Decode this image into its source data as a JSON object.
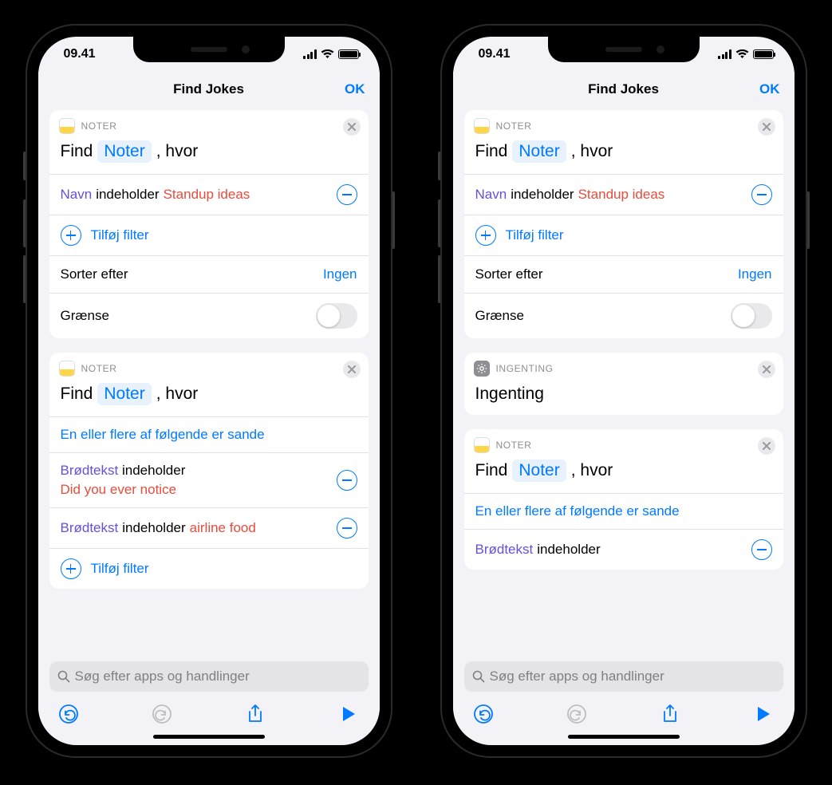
{
  "status": {
    "time": "09.41"
  },
  "nav": {
    "title": "Find Jokes",
    "done": "OK"
  },
  "tokens": {
    "find": "Find",
    "notes_token": "Noter",
    "where": ", hvor"
  },
  "apps": {
    "notes": "NOTER",
    "nothing": "INGENTING"
  },
  "filter1": {
    "attr": "Navn",
    "op": "indeholder",
    "val": "Standup ideas"
  },
  "add_filter": "Tilføj filter",
  "sort": {
    "label": "Sorter efter",
    "value": "Ingen"
  },
  "limit": {
    "label": "Grænse"
  },
  "cond_group": "En eller flere af følgende er sande",
  "filter2a": {
    "attr": "Brødtekst",
    "op": "indeholder",
    "val": "Did you ever notice"
  },
  "filter2b": {
    "attr": "Brødtekst",
    "op": "indeholder",
    "val": "airline food"
  },
  "nothing_title": "Ingenting",
  "search": {
    "placeholder": "Søg efter apps og handlinger"
  }
}
